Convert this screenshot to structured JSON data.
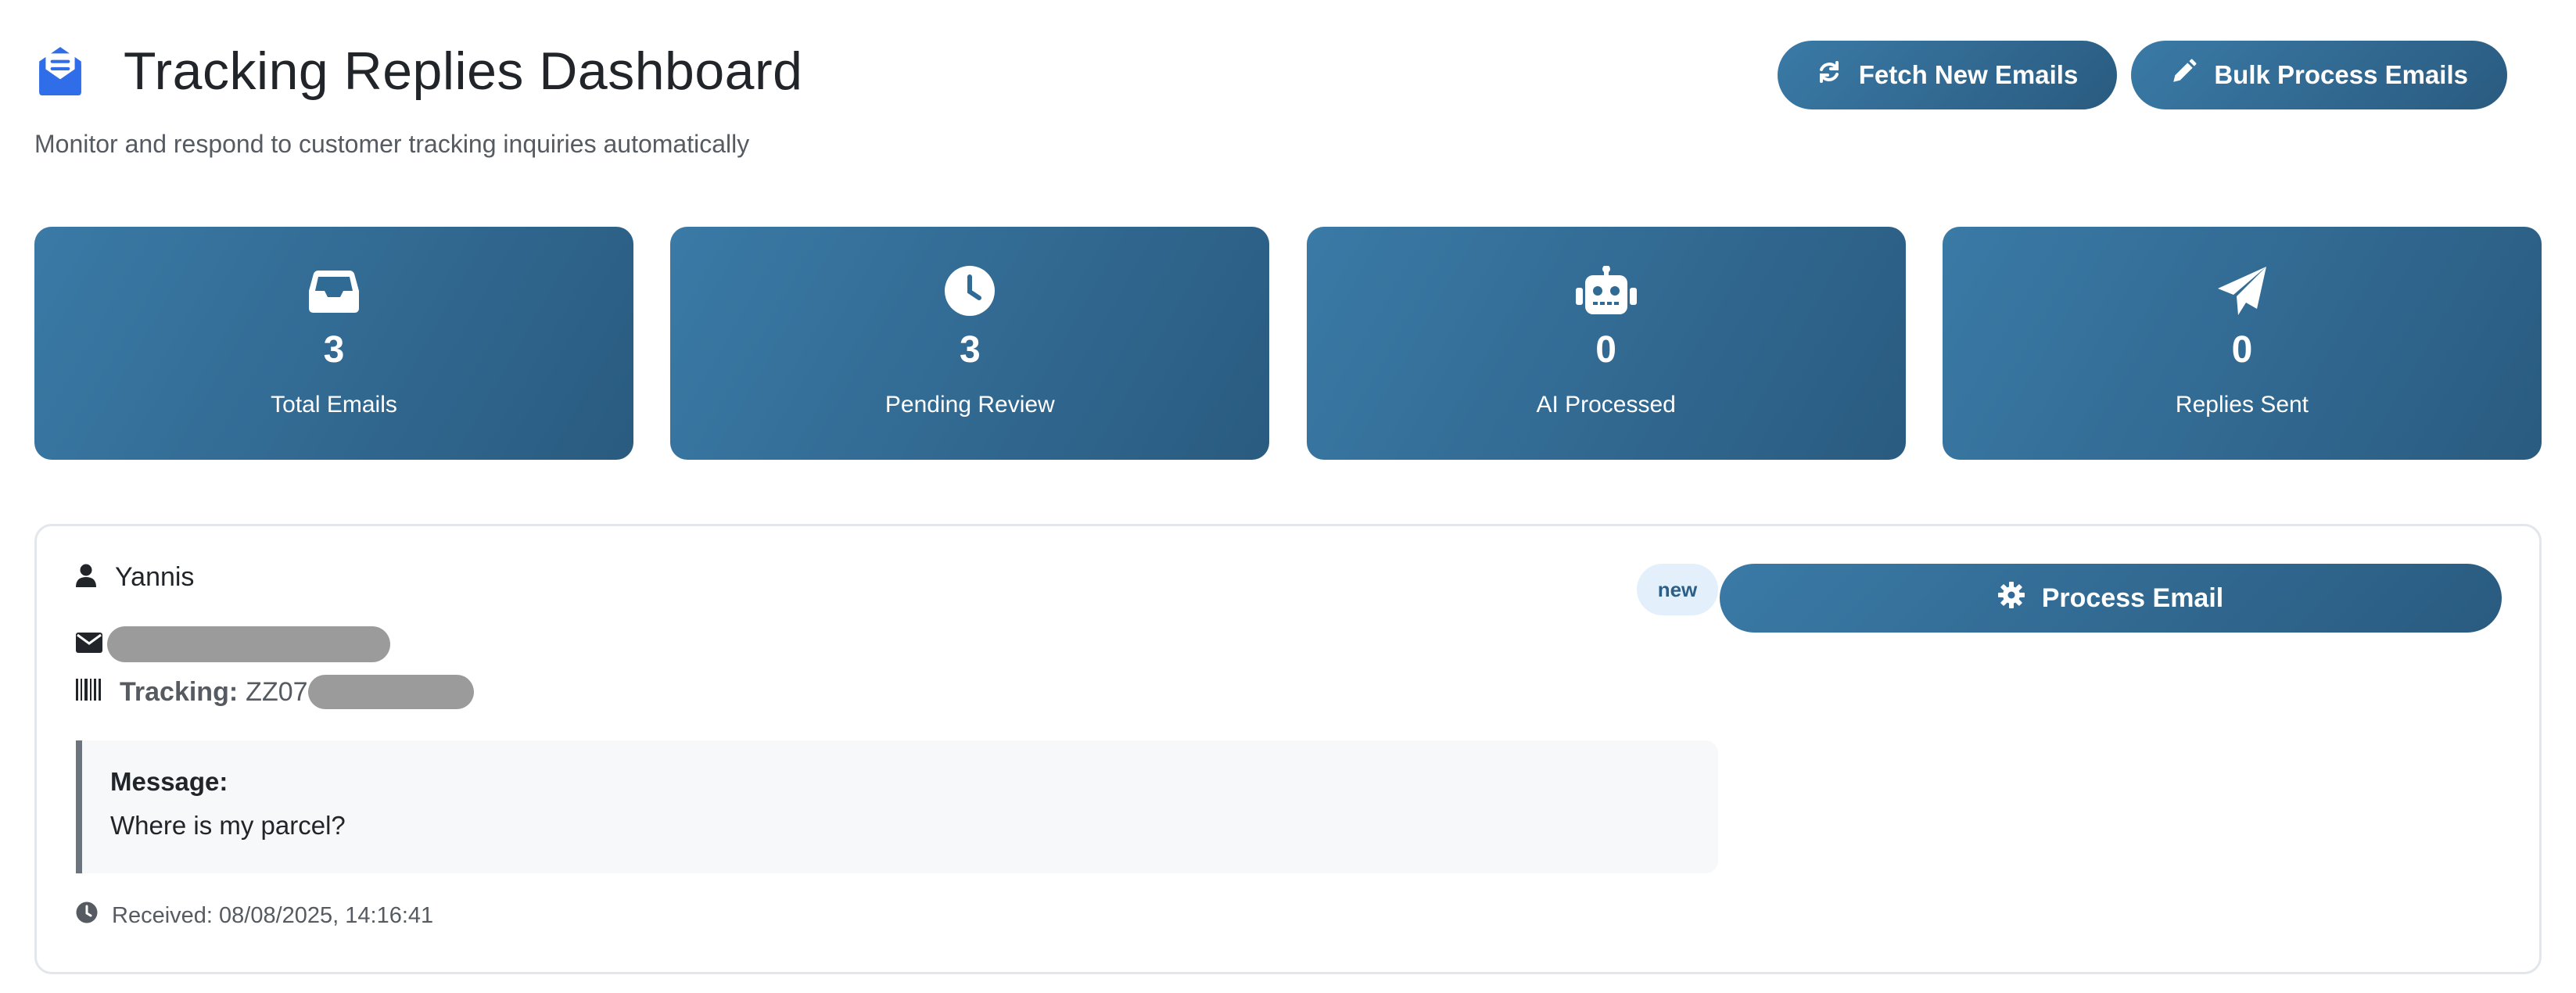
{
  "header": {
    "title": "Tracking Replies Dashboard",
    "subtitle": "Monitor and respond to customer tracking inquiries automatically",
    "icon": "envelope-open-text-icon",
    "actions": {
      "fetch_label": "Fetch New Emails",
      "bulk_label": "Bulk Process Emails"
    }
  },
  "stats": [
    {
      "icon": "inbox-icon",
      "value": "3",
      "label": "Total Emails"
    },
    {
      "icon": "clock-icon",
      "value": "3",
      "label": "Pending Review"
    },
    {
      "icon": "robot-icon",
      "value": "0",
      "label": "AI Processed"
    },
    {
      "icon": "paper-plane-icon",
      "value": "0",
      "label": "Replies Sent"
    }
  ],
  "email": {
    "sender": "Yannis",
    "status": "new",
    "tracking_label": "Tracking:",
    "tracking_prefix": "ZZ07",
    "message_heading": "Message:",
    "message_text": "Where is my parcel?",
    "received": "Received: 08/08/2025, 14:16:41",
    "process_label": "Process Email"
  },
  "colors": {
    "primary_start": "#3a7aa6",
    "primary_end": "#2a5b80",
    "badge_bg": "#e3f0fb",
    "badge_text": "#2c5f88",
    "brand_icon": "#2f6ee8"
  }
}
